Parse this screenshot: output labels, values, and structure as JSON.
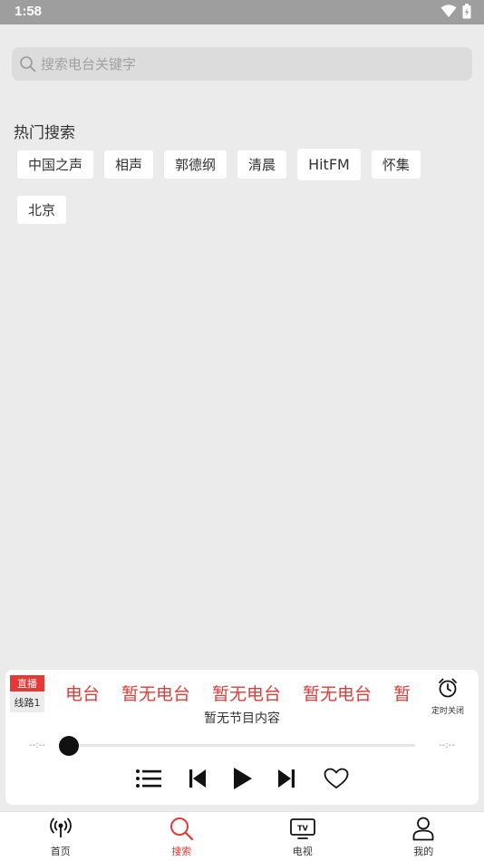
{
  "status_bar": {
    "time": "1:58"
  },
  "search": {
    "placeholder": "搜索电台关键字",
    "value": ""
  },
  "hot": {
    "title": "热门搜索",
    "tags": [
      "中国之声",
      "相声",
      "郭德纲",
      "清晨",
      "HitFM",
      "怀集",
      "北京"
    ],
    "active_tag": "HitFM"
  },
  "player": {
    "live_badge": "直播",
    "line_badge": "线路1",
    "marquee": [
      "电台",
      "暂无电台",
      "暂无电台",
      "暂无电台",
      "暂"
    ],
    "timer_label": "定时关闭",
    "program": "暂无节目内容",
    "time_elapsed": "--:--",
    "time_total": "--:--",
    "progress": 0,
    "accent_color": "#e53935"
  },
  "nav": {
    "items": [
      {
        "label": "首页",
        "icon": "broadcast-icon"
      },
      {
        "label": "搜索",
        "icon": "search-icon"
      },
      {
        "label": "电视",
        "icon": "tv-icon"
      },
      {
        "label": "我的",
        "icon": "person-icon"
      }
    ],
    "active": "搜索",
    "active_color": "#e53935"
  }
}
